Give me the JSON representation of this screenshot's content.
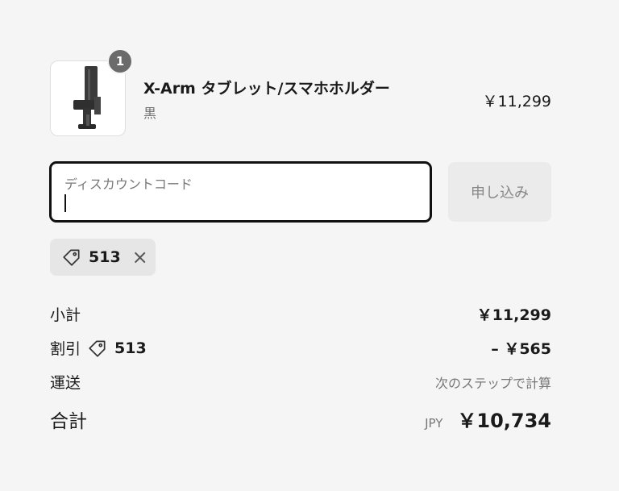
{
  "line_item": {
    "quantity": "1",
    "title": "X-Arm タブレット/スマホホルダー",
    "variant": "黒",
    "price": "￥11,299"
  },
  "discount_input": {
    "label": "ディスカウントコード",
    "value": ""
  },
  "apply_button": {
    "label": "申し込み"
  },
  "applied_code": {
    "code": "513"
  },
  "summary": {
    "subtotal_label": "小計",
    "subtotal_value": "￥11,299",
    "discount_label": "割引",
    "discount_code": "513",
    "discount_value": "– ￥565",
    "shipping_label": "運送",
    "shipping_value": "次のステップで計算",
    "total_label": "合計",
    "currency": "JPY",
    "total_value": "￥10,734"
  },
  "colors": {
    "background": "#f5f5f5",
    "badge": "#6b6b6b",
    "input_border": "#111111",
    "chip_background": "#e6e6e6"
  }
}
